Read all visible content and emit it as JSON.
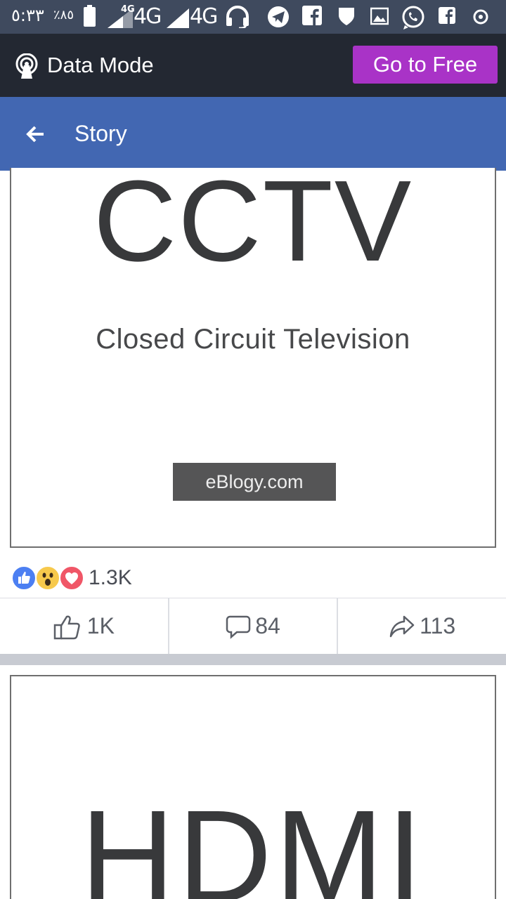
{
  "status_bar": {
    "time": "٥:٣٣",
    "battery_percent": "٪٨٥",
    "network_1": "4G",
    "network_1_small": "4G",
    "network_2": "4G",
    "icons": [
      "battery-icon",
      "signal-icon",
      "signal-icon",
      "headset-icon",
      "telegram-icon",
      "facebook-icon",
      "shield-icon",
      "gallery-icon",
      "whatsapp-icon",
      "facebook-icon",
      "circle-icon"
    ]
  },
  "data_mode": {
    "label": "Data Mode",
    "go_free_label": "Go to Free",
    "button_color": "#a933c7"
  },
  "header": {
    "title": "Story",
    "color": "#4267b2"
  },
  "post1": {
    "image_title": "CCTV",
    "image_subtitle": "Closed Circuit Television",
    "image_badge": "eBlogy.com",
    "reactions": [
      "like",
      "wow",
      "love"
    ],
    "reaction_count": "1.3K",
    "like_count": "1K",
    "comment_count": "84",
    "share_count": "113"
  },
  "post2": {
    "image_title": "HDMI"
  }
}
